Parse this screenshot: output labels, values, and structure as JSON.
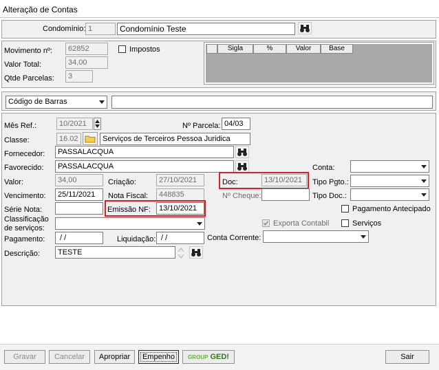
{
  "window": {
    "title": "Alteração de Contas"
  },
  "condominio": {
    "label": "Condomínio:",
    "code": "1",
    "name": "Condomínio Teste"
  },
  "movimento": {
    "numero_label": "Movimento nº:",
    "numero": "62852",
    "impostos_label": "Impostos",
    "impostos_checked": false,
    "valor_total_label": "Valor Total:",
    "valor_total": "34,00",
    "qtde_parcelas_label": "Qtde Parcelas:",
    "qtde_parcelas": "3"
  },
  "impostos_grid": {
    "columns": [
      "Sigla",
      "%",
      "Valor",
      "Base"
    ]
  },
  "barcode": {
    "selected": "Código de Barras",
    "value": ""
  },
  "form": {
    "mes_ref_label": "Mês Ref.:",
    "mes_ref": "10/2021",
    "parcela_label": "Nº Parcela:",
    "parcela": "04/03",
    "classe_label": "Classe:",
    "classe_code": "16.02",
    "classe_name": "Serviços de Terceiros Pessoa Juridica",
    "fornecedor_label": "Fornecedor:",
    "fornecedor": "PASSALACQUA",
    "favorecido_label": "Favorecido:",
    "favorecido": "PASSALACQUA",
    "conta_label": "Conta:",
    "conta": "",
    "valor_label": "Valor:",
    "valor": "34,00",
    "criacao_label": "Criação:",
    "criacao": "27/10/2021",
    "doc_label": "Doc:",
    "doc": "13/10/2021",
    "tipo_pgto_label": "Tipo Pgto.:",
    "tipo_pgto": "",
    "vencimento_label": "Vencimento:",
    "vencimento": "25/11/2021",
    "nota_fiscal_label": "Nota Fiscal:",
    "nota_fiscal": "448835",
    "cheque_label": "Nº Cheque:",
    "cheque": "",
    "tipo_doc_label": "Tipo Doc.:",
    "tipo_doc": "",
    "serie_nota_label": "Série Nota:",
    "serie_nota": "",
    "emissao_nf_label": "Emissão NF:",
    "emissao_nf": "13/10/2021",
    "pagamento_antecipado_label": "Pagamento Antecipado",
    "classificacao_label_1": "Classificação",
    "classificacao_label_2": "de serviços:",
    "classificacao": "",
    "exporta_contabil_label": "Exporta Contabil",
    "exporta_contabil_checked": true,
    "servicos_label": "Serviços",
    "pagamento_label": "Pagamento:",
    "pagamento": " / /",
    "liquidacao_label": "Liquidação:",
    "liquidacao": " / /",
    "conta_corrente_label": "Conta Corrente:",
    "conta_corrente": "",
    "descricao_label": "Descrição:",
    "descricao": "TESTE"
  },
  "buttons": {
    "gravar": "Gravar",
    "cancelar": "Cancelar",
    "apropriar": "Apropriar",
    "empenho": "Empenho",
    "ged_group": "GROUP",
    "ged_text": "GED!",
    "sair": "Sair"
  },
  "colors": {
    "highlight": "#e01e1e",
    "ged_green": "#5cb82e"
  }
}
